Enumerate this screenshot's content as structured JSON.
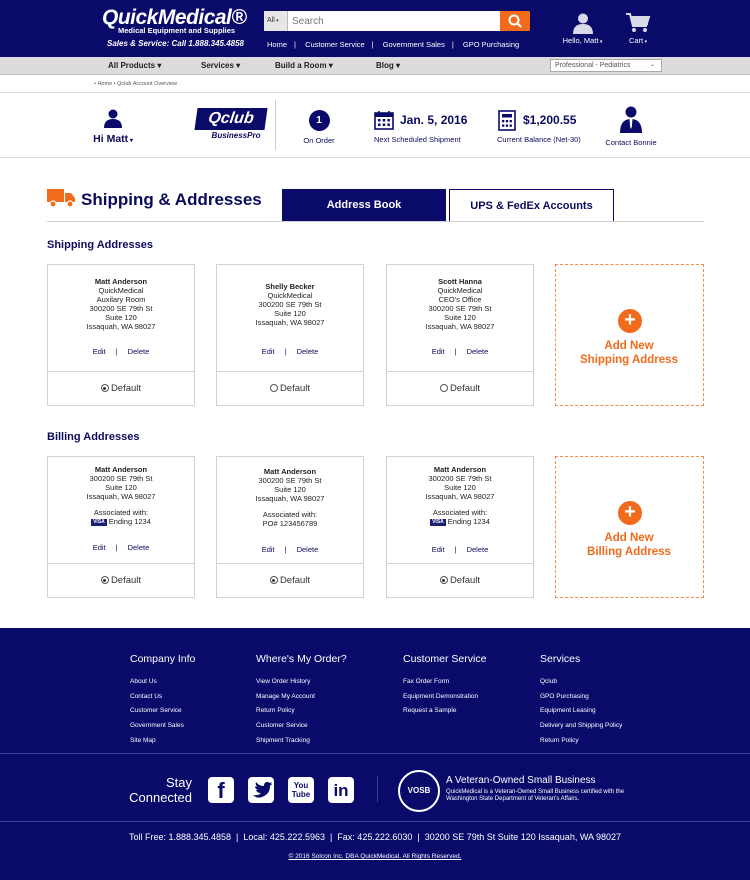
{
  "header": {
    "logo": "QuickMedical®",
    "logo_sub": "Medical Equipment and Supplies",
    "phone": "Sales & Service: Call 1.888.345.4858",
    "search": {
      "category": "All",
      "placeholder": "Search"
    },
    "nav": [
      "Home",
      "Customer Service",
      "Government Sales",
      "GPO Purchasing"
    ],
    "account_label": "Hello, Matt",
    "cart_label": "Cart"
  },
  "category_bar": {
    "items": [
      "All Products",
      "Services",
      "Build a Room",
      "Blog"
    ],
    "pro_select": "Professional - Pediatrics"
  },
  "breadcrumb": "• Home • Qclub Account Overview",
  "account_strip": {
    "greeting": "Hi Matt",
    "qclub_logo": "Qclub",
    "qclub_sub": "BusinessPro",
    "on_order_count": "1",
    "on_order_label": "On Order",
    "next_shipment_date": "Jan. 5, 2016",
    "next_shipment_label": "Next Scheduled Shipment",
    "balance": "$1,200.55",
    "balance_label": "Current Balance (Net-30)",
    "contact_label": "Contact Bonnie"
  },
  "section": {
    "title": "Shipping & Addresses",
    "tabs": [
      "Address Book",
      "UPS & FedEx Accounts"
    ]
  },
  "shipping": {
    "title": "Shipping Addresses",
    "cards": [
      {
        "name": "Matt Anderson",
        "lines": [
          "QuickMedical",
          "Auxilary Room",
          "300200 SE 79th St",
          "Suite 120",
          "Issaquah, WA 98027"
        ],
        "edit": "Edit",
        "delete": "Delete",
        "default": "Default",
        "is_default": true
      },
      {
        "name": "Shelly Becker",
        "lines": [
          "QuickMedical",
          "300200 SE 79th St",
          "Suite 120",
          "Issaquah, WA 98027"
        ],
        "edit": "Edit",
        "delete": "Delete",
        "default": "Default",
        "is_default": false
      },
      {
        "name": "Scott Hanna",
        "lines": [
          "QuickMedical",
          "CEO's Office",
          "300200 SE 79th St",
          "Suite 120",
          "Issaquah, WA 98027"
        ],
        "edit": "Edit",
        "delete": "Delete",
        "default": "Default",
        "is_default": false
      }
    ],
    "add_label_1": "Add New",
    "add_label_2": "Shipping Address"
  },
  "billing": {
    "title": "Billing Addresses",
    "cards": [
      {
        "name": "Matt Anderson",
        "lines": [
          "300200 SE 79th St",
          "Suite 120",
          "Issaquah, WA 98027"
        ],
        "assoc": "Associated with:",
        "assoc_detail": "Ending 1234",
        "card_brand": "VISA",
        "edit": "Edit",
        "delete": "Delete",
        "default": "Default"
      },
      {
        "name": "Matt Anderson",
        "lines": [
          "300200 SE 79th St",
          "Suite 120",
          "Issaquah, WA 98027"
        ],
        "assoc": "Associated with:",
        "assoc_detail": "PO# 123456789",
        "card_brand": "",
        "edit": "Edit",
        "delete": "Delete",
        "default": "Default"
      },
      {
        "name": "Matt Anderson",
        "lines": [
          "300200 SE 79th St",
          "Suite 120",
          "Issaquah, WA 98027"
        ],
        "assoc": "Associated with:",
        "assoc_detail": "Ending 1234",
        "card_brand": "VISA",
        "edit": "Edit",
        "delete": "Delete",
        "default": "Default"
      }
    ],
    "add_label_1": "Add New",
    "add_label_2": "Billing Address"
  },
  "footer": {
    "columns": [
      {
        "title": "Company Info",
        "links": [
          "About Us",
          "Contact Us",
          "Customer Service",
          "Government Sales",
          "Site Map"
        ]
      },
      {
        "title": "Where's My Order?",
        "links": [
          "View Order History",
          "Manage My Account",
          "Return Policy",
          "Customer Service",
          "Shipment Tracking"
        ]
      },
      {
        "title": "Customer Service",
        "links": [
          "Fax Order Form",
          "Equipment Demonstration",
          "Request a Sample"
        ]
      },
      {
        "title": "Services",
        "links": [
          "Qclub",
          "GPO Purchasing",
          "Equipment Leasing",
          "Delivery and Shipping Policy",
          "Return Policy"
        ]
      }
    ],
    "stay_1": "Stay",
    "stay_2": "Connected",
    "social": [
      "f",
      "t",
      "You Tube",
      "in"
    ],
    "vosb_badge": "VOSB",
    "vosb_title": "A Veteran-Owned Small Business",
    "vosb_text": "QuickMedical is a Veteran-Owned Small Business certified with the Washington State Department of Veteran's Affairs.",
    "contact": "Toll Free: 1.888.345.4858  |  Local: 425.222.5963  |  Fax: 425.222.6030  |  30200 SE 79th St Suite 120 Issaquah, WA 98027",
    "copyright": "© 2016 Solcon Inc. DBA QuickMedical. All Rights Reserved."
  },
  "colors": {
    "navy": "#0a0a6b",
    "orange": "#f26a1b"
  }
}
